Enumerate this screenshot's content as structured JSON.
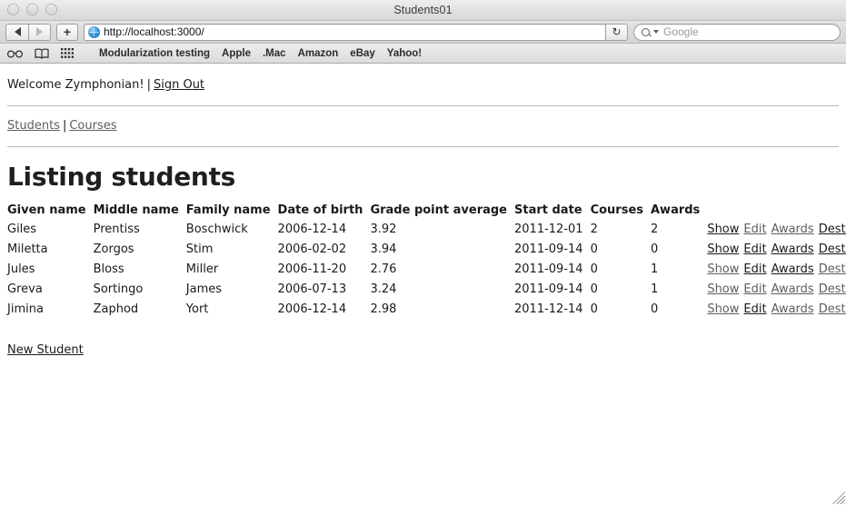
{
  "window": {
    "title": "Students01",
    "traffic_lights": [
      "close",
      "minimize",
      "zoom"
    ]
  },
  "toolbar": {
    "back_label": "◀",
    "forward_label": "▶",
    "add_tab_label": "+",
    "reload_label": "↻",
    "url": "http://localhost:3000/",
    "search_placeholder": "Google"
  },
  "bookmarks_bar": {
    "icons": [
      "reader-glasses-icon",
      "bookmarks-book-icon",
      "top-sites-grid-icon"
    ],
    "items": [
      {
        "label": "Modularization testing"
      },
      {
        "label": "Apple"
      },
      {
        "label": ".Mac"
      },
      {
        "label": "Amazon"
      },
      {
        "label": "eBay"
      },
      {
        "label": "Yahoo!"
      }
    ]
  },
  "page": {
    "welcome_text": "Welcome Zymphonian!",
    "separator": "|",
    "sign_out_label": "Sign Out",
    "nav": [
      {
        "label": "Students"
      },
      {
        "label": "Courses"
      }
    ],
    "title": "Listing students",
    "new_student_label": "New Student",
    "table": {
      "headers": [
        "Given name",
        "Middle name",
        "Family name",
        "Date of birth",
        "Grade point average",
        "Start date",
        "Courses",
        "Awards"
      ],
      "action_labels": [
        "Show",
        "Edit",
        "Awards",
        "Destroy"
      ],
      "rows": [
        {
          "given_name": "Giles",
          "middle_name": "Prentiss",
          "family_name": "Boschwick",
          "date_of_birth": "2006-12-14",
          "gpa": "3.92",
          "start_date": "2011-12-01",
          "courses": "2",
          "awards": "2"
        },
        {
          "given_name": "Miletta",
          "middle_name": "Zorgos",
          "family_name": "Stim",
          "date_of_birth": "2006-02-02",
          "gpa": "3.94",
          "start_date": "2011-09-14",
          "courses": "0",
          "awards": "0"
        },
        {
          "given_name": "Jules",
          "middle_name": "Bloss",
          "family_name": "Miller",
          "date_of_birth": "2006-11-20",
          "gpa": "2.76",
          "start_date": "2011-09-14",
          "courses": "0",
          "awards": "1"
        },
        {
          "given_name": "Greva",
          "middle_name": "Sortingo",
          "family_name": "James",
          "date_of_birth": "2006-07-13",
          "gpa": "3.24",
          "start_date": "2011-09-14",
          "courses": "0",
          "awards": "1"
        },
        {
          "given_name": "Jimina",
          "middle_name": "Zaphod",
          "family_name": "Yort",
          "date_of_birth": "2006-12-14",
          "gpa": "2.98",
          "start_date": "2011-12-14",
          "courses": "0",
          "awards": "0"
        }
      ]
    }
  },
  "colors": {
    "link": "#1a1a1a",
    "link_gray": "#5e5e5e",
    "rule": "#b9b9b9",
    "chrome_bg": "#dcdcdc"
  }
}
